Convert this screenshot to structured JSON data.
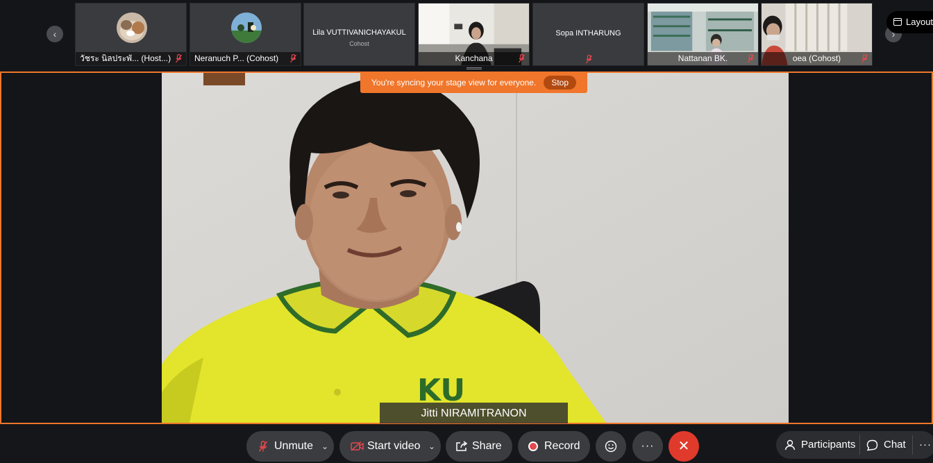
{
  "strip": {
    "tiles": [
      {
        "name": "วัชระ นิลประพั...  (Host...)",
        "muted": true
      },
      {
        "name": "Neranuch P...  (Cohost)",
        "muted": true
      },
      {
        "name": "Lila VUTTIVANICHAYAKUL",
        "role": "Cohost"
      },
      {
        "name": "Kanchana",
        "muted": true
      },
      {
        "name": "Sopa INTHARUNG",
        "muted": true
      },
      {
        "name": "Nattanan BK.",
        "muted": true
      },
      {
        "name": "oea  (Cohost)",
        "muted": true
      }
    ],
    "layout_label": "Layout"
  },
  "stage": {
    "sync_message": "You're syncing your stage view for everyone.",
    "stop_label": "Stop",
    "speaker_name": "Jitti NIRAMITRANON",
    "shirt_text": "KU"
  },
  "toolbar": {
    "unmute_label": "Unmute",
    "start_video_label": "Start video",
    "share_label": "Share",
    "record_label": "Record",
    "participants_label": "Participants",
    "chat_label": "Chat",
    "more_label": "···",
    "end_label": "✕"
  },
  "colors": {
    "accent_orange": "#f0762b",
    "end_red": "#e03a2d",
    "muted_red": "#e5484d"
  }
}
